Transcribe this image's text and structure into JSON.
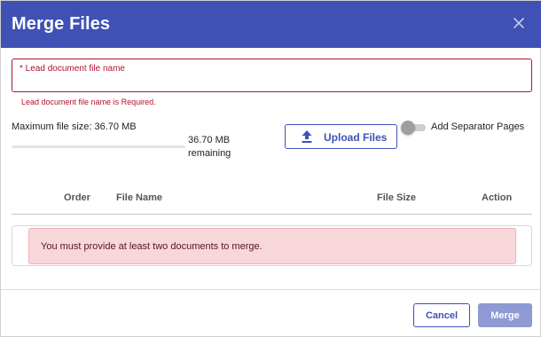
{
  "dialog": {
    "title": "Merge Files",
    "close_icon": "close-icon",
    "header_color": "#3f51b5"
  },
  "lead_field": {
    "label": "* Lead document file name",
    "value": "",
    "error": "Lead document file name is Required."
  },
  "upload": {
    "max_size_text": "Maximum file size: 36.70 MB",
    "remaining_text": "36.70 MB remaining",
    "used_fraction": 0,
    "button_label": "Upload Files",
    "button_icon": "upload-icon"
  },
  "separator": {
    "label": "Add Separator Pages",
    "enabled": false
  },
  "table": {
    "columns": [
      "Order",
      "File Name",
      "File Size",
      "Action"
    ],
    "empty_message": "You must provide at least two documents to merge."
  },
  "footer": {
    "cancel_label": "Cancel",
    "merge_label": "Merge",
    "merge_enabled": false
  },
  "colors": {
    "accent": "#3f51b5",
    "error": "#b0122b",
    "alert_bg": "#f8d7da"
  }
}
